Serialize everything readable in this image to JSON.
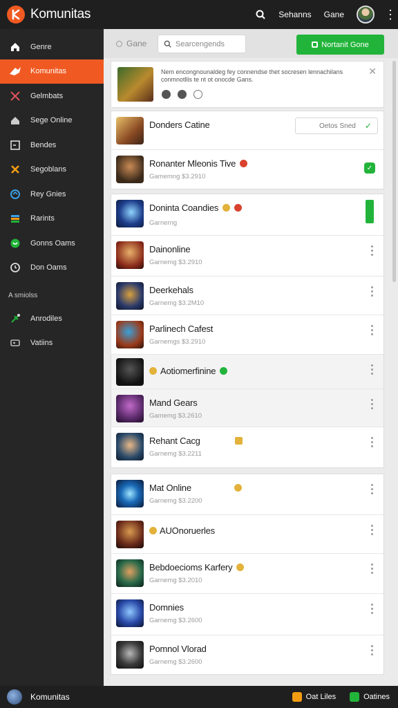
{
  "app": {
    "title": "Komunitas",
    "top_links": [
      "Sehanns",
      "Gane"
    ]
  },
  "colors": {
    "accent": "#f05a22",
    "green": "#22b43a",
    "sidebar_bg": "#262626",
    "topbar_bg": "#1f1f1f"
  },
  "sidebar": {
    "items": [
      {
        "label": "Genre",
        "icon": "home-icon"
      },
      {
        "label": "Komunitas",
        "icon": "community-icon",
        "active": true
      },
      {
        "label": "Gelmbats",
        "icon": "crossed-swords-icon"
      },
      {
        "label": "Sege Online",
        "icon": "house-icon"
      },
      {
        "label": "Bendes",
        "icon": "square-icon"
      },
      {
        "label": "Segoblans",
        "icon": "x-icon"
      },
      {
        "label": "Rey Gnies",
        "icon": "globe-icon"
      },
      {
        "label": "Rarints",
        "icon": "bars-icon"
      },
      {
        "label": "Gonns Oams",
        "icon": "chat-icon"
      },
      {
        "label": "Don Oams",
        "icon": "clock-icon"
      }
    ],
    "section": "A smiolss",
    "items2": [
      {
        "label": "Anrodiles",
        "icon": "rocket-icon"
      },
      {
        "label": "Vatiins",
        "icon": "tag-icon"
      }
    ]
  },
  "filter": {
    "radio_label": "Gane",
    "search_placeholder": "Searcengends",
    "button_label": "Nortanit Gone"
  },
  "notice": {
    "text": "Nem encongnounaldeg fey connendse thet socresen lennachilans conmnotllis te nt ot onocde Gans."
  },
  "card1": {
    "rows": [
      {
        "title": "Donders Catine",
        "sub": "",
        "status": "Oetos Sned"
      },
      {
        "title": "Ronanter Mleonis  Tive",
        "sub": "Gamemng $3.2910"
      }
    ]
  },
  "card2": {
    "rows": [
      {
        "title": "Doninta Coandies",
        "sub": "Garnerng"
      },
      {
        "title": "Dainonline",
        "sub": "Garnemg $3.2910"
      },
      {
        "title": "Deerkehals",
        "sub": "Garnemg $3.2M10"
      },
      {
        "title": "Parlinech Cafest",
        "sub": "Garnemgs $3.2910"
      },
      {
        "title": "Aotiomerfinine",
        "sub": ""
      },
      {
        "title": "Mand Gears",
        "sub": "Gamemg $3.2610"
      },
      {
        "title": "Rehant Cacg",
        "sub": "Garnemg $3.2211"
      }
    ]
  },
  "card3": {
    "rows": [
      {
        "title": "Mat Online",
        "sub": "Garnemg $3.2200"
      },
      {
        "title": "AUOnoruerles",
        "sub": ""
      },
      {
        "title": "Bebdoecioms  Karfery",
        "sub": "Garnemg $3.2010"
      },
      {
        "title": "Domnies",
        "sub": "Garnemg $3.2600"
      },
      {
        "title": "Pomnol Vlorad",
        "sub": "Garnemg $3.2600"
      }
    ]
  },
  "bottom": {
    "title": "Komunitas",
    "links": [
      "Oat Liles",
      "Oatines"
    ]
  }
}
